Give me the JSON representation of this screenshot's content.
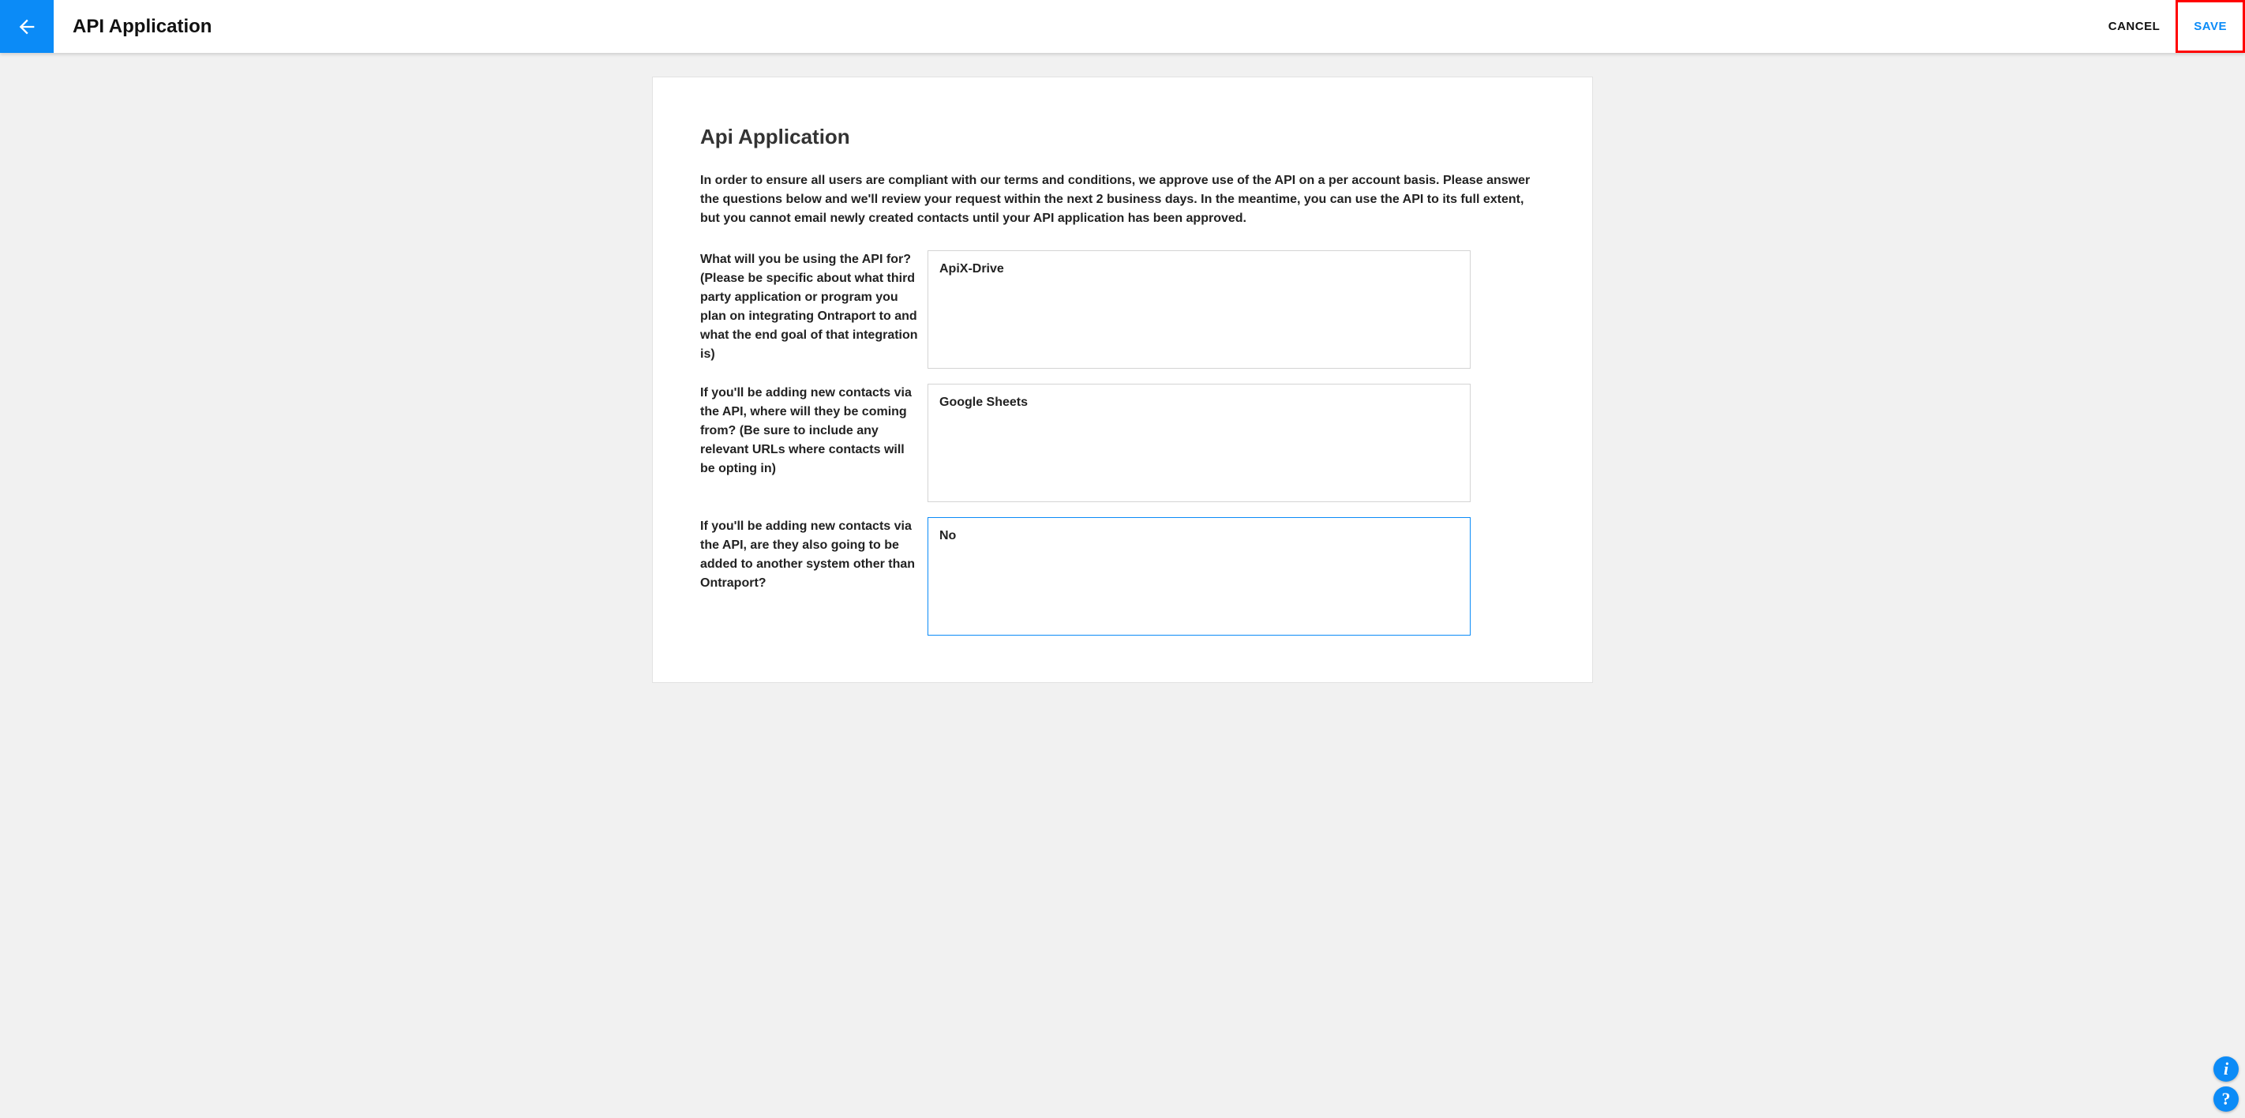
{
  "header": {
    "title": "API Application",
    "cancel_label": "CANCEL",
    "save_label": "SAVE"
  },
  "card": {
    "title": "Api Application",
    "intro": "In order to ensure all users are compliant with our terms and conditions, we approve use of the API on a per account basis. Please answer the questions below and we'll review your request within the next 2 business days. In the meantime, you can use the API to its full extent, but you cannot email newly created contacts until your API application has been approved."
  },
  "fields": [
    {
      "label": "What will you be using the API for? (Please be specific about what third party application or program you plan on integrating Ontraport to and what the end goal of that integration is)",
      "value": "ApiX-Drive",
      "focused": false
    },
    {
      "label": "If you'll be adding new contacts via the API, where will they be coming from? (Be sure to include any relevant URLs where contacts will be opting in)",
      "value": "Google Sheets",
      "focused": false
    },
    {
      "label": "If you'll be adding new contacts via the API, are they also going to be added to another system other than Ontraport?",
      "value": "No",
      "focused": true
    }
  ]
}
